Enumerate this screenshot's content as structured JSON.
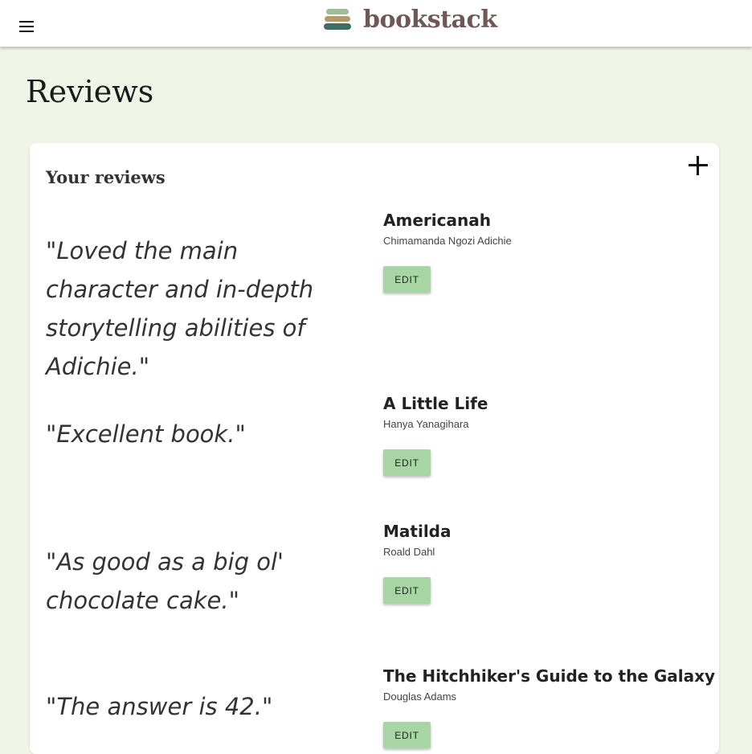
{
  "header": {
    "brand_name": "bookstack",
    "logo_colors": [
      "#9fbe93",
      "#b29b68",
      "#3f6e6a"
    ]
  },
  "page": {
    "title": "Reviews"
  },
  "card": {
    "title": "Your reviews"
  },
  "reviews": [
    {
      "quote": "\"Loved the main character and in-depth storytelling abilities of Adichie.\"",
      "title": "Americanah",
      "author": "Chimamanda Ngozi Adichie",
      "edit_label": "EDIT"
    },
    {
      "quote": "\"Excellent book.\"",
      "title": "A Little Life",
      "author": "Hanya Yanagihara",
      "edit_label": "EDIT"
    },
    {
      "quote": "\"As good as a big ol' chocolate cake.\"",
      "title": "Matilda",
      "author": "Roald Dahl",
      "edit_label": "EDIT"
    },
    {
      "quote": "\"The answer is 42.\"",
      "title": "The Hitchhiker's Guide to the Galaxy",
      "author": "Douglas Adams",
      "edit_label": "EDIT"
    }
  ],
  "colors": {
    "background": "#f0f5e7",
    "brand": "#6e5856",
    "edit_button": "#a8d5a4"
  }
}
